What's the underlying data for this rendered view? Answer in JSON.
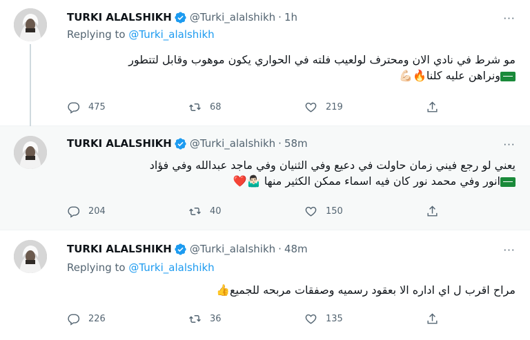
{
  "colors": {
    "accent": "#1d9bf0",
    "muted": "#536471",
    "text": "#0f1419",
    "highlight_bg": "#f7f9f9"
  },
  "tweets": [
    {
      "name": "TURKI ALALSHIKH",
      "handle": "@Turki_alalshikh",
      "time": "1h",
      "replying_label": "Replying to",
      "replying_handle": "@Turki_alalshikh",
      "text_line1": "مو شرط في نادي الان ومحترف لولعيب فلته في الحواري يكون موهوب وقابل لتتطور",
      "text_line2": "ونراهن عليه كلنا🔥💪🏻",
      "replies": "475",
      "retweets": "68",
      "likes": "219"
    },
    {
      "name": "TURKI ALALSHIKH",
      "handle": "@Turki_alalshikh",
      "time": "58m",
      "text_line1": "يعني لو رجع فيني زمان حاولت في دعيع وفي الثنيان وفي ماجد عبدالله وفي فؤاد",
      "text_line2": "انور وفي محمد نور كان فيه اسماء ممكن الكثير منها 🤷🏻‍♂️❤️",
      "replies": "204",
      "retweets": "40",
      "likes": "150"
    },
    {
      "name": "TURKI ALALSHIKH",
      "handle": "@Turki_alalshikh",
      "time": "48m",
      "replying_label": "Replying to",
      "replying_handle": "@Turki_alalshikh",
      "text_line1": "مراح اقرب ل اي اداره الا بعقود رسميه وصفقات مربحه للجميع👍",
      "replies": "226",
      "retweets": "36",
      "likes": "135"
    }
  ]
}
